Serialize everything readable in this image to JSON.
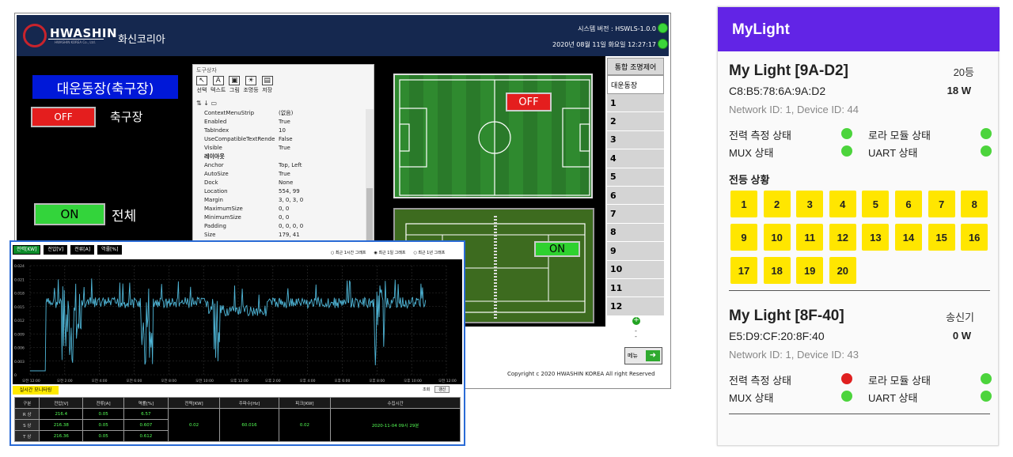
{
  "desktop": {
    "brand": "HWASHIN",
    "brand_sub": "HWASHIN KOREA Co., Ltd.",
    "corp": "화신코리아",
    "version": "시스템 버전 : HSWLS-1.0.0",
    "datetime": "2020년 08월 11일 화요일 12:27:17",
    "venue_title": "대운동장(축구장)",
    "off_label": "OFF",
    "field_label": "축구장",
    "on_label": "ON",
    "all_label": "전체",
    "soccer_status": "OFF",
    "tennis_status": "ON",
    "zone_header": "통합 조명제어",
    "zone_selected": "대운동장",
    "zones": [
      "1",
      "2",
      "3",
      "4",
      "5",
      "6",
      "7",
      "8",
      "9",
      "10",
      "11",
      "12"
    ],
    "nav_up": "+",
    "nav_dots": "-",
    "menu": "메뉴",
    "copyright": "Copyright c 2020 HWASHIN KOREA All right Reserved",
    "props": {
      "title": "도구상자",
      "tools": [
        "선택",
        "텍스트",
        "그림",
        "조명등",
        "저장"
      ],
      "tool_icons": [
        "↖",
        "A",
        "▣",
        "☀",
        "▤"
      ],
      "rows": [
        [
          "ContextMenuStrip",
          "(없음)"
        ],
        [
          "Enabled",
          "True"
        ],
        [
          "TabIndex",
          "10"
        ],
        [
          "UseCompatibleTextRende",
          "False"
        ],
        [
          "Visible",
          "True"
        ],
        [
          "레이아웃",
          ""
        ],
        [
          "Anchor",
          "Top, Left"
        ],
        [
          "AutoSize",
          "True"
        ],
        [
          "Dock",
          "None"
        ],
        [
          "Location",
          "554, 99"
        ],
        [
          "Margin",
          "3, 0, 3, 0"
        ],
        [
          "MaximumSize",
          "0, 0"
        ],
        [
          "MinimumSize",
          "0, 0"
        ],
        [
          "Padding",
          "0, 0, 0, 0"
        ],
        [
          "Size",
          "179, 41"
        ]
      ]
    },
    "monitor": {
      "tabs": [
        "전력[KW]",
        "전압[V]",
        "전류[A]",
        "역률[%]"
      ],
      "radios": [
        "최근 1시간 그래프",
        "최근 1일 그래프",
        "최근 1년 그래프"
      ],
      "y_ticks": [
        "0.024",
        "0.021",
        "0.018",
        "0.015",
        "0.012",
        "0.009",
        "0.006",
        "0.003",
        "0"
      ],
      "x_ticks": [
        "오전 12:00",
        "오전 2:00",
        "오전 4:00",
        "오전 6:00",
        "오전 8:00",
        "오전 10:00",
        "오후 12:00",
        "오후 2:00",
        "오후 4:00",
        "오후 6:00",
        "오후 8:00",
        "오후 10:00",
        "오전 12:00"
      ],
      "realtime_label": "실시간 모니터링",
      "ctl_label": "조회",
      "ctl_btn": "갱신",
      "table_headers": [
        "구분",
        "전압[V]",
        "전류[A]",
        "역률[%]",
        "전력[KW]",
        "주파수[Hz]",
        "피크[KW]",
        "수집시간"
      ],
      "rows": [
        {
          "phase": "R 상",
          "v": "216.4",
          "a": "0.05",
          "pf": "6.57"
        },
        {
          "phase": "S 상",
          "v": "216.38",
          "a": "0.05",
          "pf": "0.607"
        },
        {
          "phase": "T 상",
          "v": "216.36",
          "a": "0.05",
          "pf": "0.612"
        }
      ],
      "power": "0.02",
      "freq": "60.016",
      "peak": "0.02",
      "collected": "2020-11-04 09시 29분"
    }
  },
  "phone": {
    "app_title": "MyLight",
    "devices": [
      {
        "name": "My Light [9A-D2]",
        "tag": "20등",
        "mac": "C8:B5:78:6A:9A:D2",
        "power": "18 W",
        "net": "Network ID: 1, Device ID: 44",
        "status": [
          {
            "label": "전력 측정 상태",
            "ok": true
          },
          {
            "label": "로라 모듈 상태",
            "ok": true
          },
          {
            "label": "MUX 상태",
            "ok": true
          },
          {
            "label": "UART 상태",
            "ok": true
          }
        ],
        "lamps_title": "전등 상황",
        "lamps": [
          "1",
          "2",
          "3",
          "4",
          "5",
          "6",
          "7",
          "8",
          "9",
          "10",
          "11",
          "12",
          "13",
          "14",
          "15",
          "16",
          "17",
          "18",
          "19",
          "20"
        ]
      },
      {
        "name": "My Light [8F-40]",
        "tag": "송신기",
        "mac": "E5:D9:CF:20:8F:40",
        "power": "0 W",
        "net": "Network ID: 1, Device ID: 43",
        "status": [
          {
            "label": "전력 측정 상태",
            "ok": false
          },
          {
            "label": "로라 모듈 상태",
            "ok": true
          },
          {
            "label": "MUX 상태",
            "ok": true
          },
          {
            "label": "UART 상태",
            "ok": true
          }
        ]
      }
    ]
  }
}
